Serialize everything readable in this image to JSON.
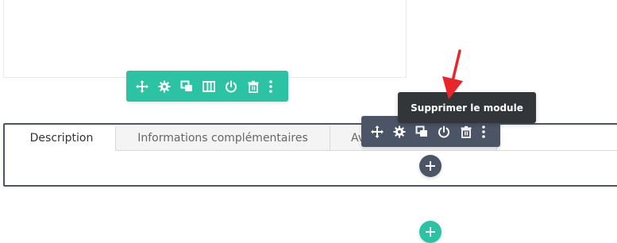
{
  "row_toolbar": {
    "color": "#2bc3a3",
    "buttons": [
      {
        "icon": "move-icon",
        "title": "Déplacer la rangée"
      },
      {
        "icon": "gear-icon",
        "title": "Paramètres de la rangée"
      },
      {
        "icon": "duplicate-icon",
        "title": "Dupliquer la rangée"
      },
      {
        "icon": "columns-icon",
        "title": "Changer la structure des colonnes"
      },
      {
        "icon": "power-icon",
        "title": "Désactiver la rangée"
      },
      {
        "icon": "trash-icon",
        "title": "Supprimer la rangée"
      },
      {
        "icon": "more-vertical-icon",
        "title": "Plus d'options"
      }
    ]
  },
  "module_toolbar": {
    "color": "#4b5566",
    "buttons": [
      {
        "icon": "move-icon",
        "title": "Déplacer le module"
      },
      {
        "icon": "gear-icon",
        "title": "Paramètres du module"
      },
      {
        "icon": "duplicate-icon",
        "title": "Dupliquer le module"
      },
      {
        "icon": "power-icon",
        "title": "Désactiver le module"
      },
      {
        "icon": "trash-icon",
        "title": "Supprimer le module"
      },
      {
        "icon": "more-vertical-icon",
        "title": "Plus d'options"
      }
    ]
  },
  "tooltip": {
    "text": "Supprimer le module",
    "color": "#333639"
  },
  "annotation": {
    "arrow_color": "#e8262a"
  },
  "tabs": {
    "items": [
      "Description",
      "Informations complémentaires",
      "Av"
    ],
    "active": "Description"
  },
  "add_buttons": {
    "module_add_color": "#4b5566",
    "row_add_color": "#2bc3a3",
    "icon": "plus-icon"
  }
}
